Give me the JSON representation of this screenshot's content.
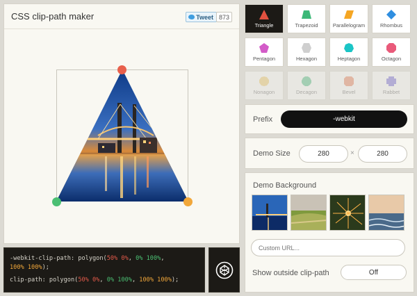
{
  "header": {
    "title": "CSS clip-path maker",
    "tweet_label": "Tweet",
    "tweet_count": "873"
  },
  "code": {
    "line1_prop": "-webkit-clip-path: polygon(",
    "line2_prop": "clip-path: polygon(",
    "p1": "50% 0%",
    "p2": "0% 100%",
    "p3": "100% 100%",
    "comma": ", ",
    "end": ");"
  },
  "shapes": [
    {
      "label": "Triangle",
      "icon": "triangle-icon",
      "color": "#e2513f",
      "active": true
    },
    {
      "label": "Trapezoid",
      "icon": "trapezoid-icon",
      "color": "#3cb878"
    },
    {
      "label": "Parallelogram",
      "icon": "parallelogram-icon",
      "color": "#f5a623"
    },
    {
      "label": "Rhombus",
      "icon": "rhombus-icon",
      "color": "#2f8ee0"
    },
    {
      "label": "Pentagon",
      "icon": "pentagon-icon",
      "color": "#d35bc8"
    },
    {
      "label": "Hexagon",
      "icon": "hexagon-icon",
      "color": "#cfcfcf"
    },
    {
      "label": "Heptagon",
      "icon": "heptagon-icon",
      "color": "#1bc5c6"
    },
    {
      "label": "Octagon",
      "icon": "octagon-icon",
      "color": "#e95a7a"
    },
    {
      "label": "Nonagon",
      "icon": "nonagon-icon",
      "color": "#f1c75c",
      "faded": true
    },
    {
      "label": "Decagon",
      "icon": "decagon-icon",
      "color": "#3cb878",
      "faded": true
    },
    {
      "label": "Bevel",
      "icon": "bevel-icon",
      "color": "#e9754c",
      "faded": true
    },
    {
      "label": "Rabbet",
      "icon": "rabbet-icon",
      "color": "#6a5bd6",
      "faded": true
    }
  ],
  "prefix": {
    "label": "Prefix",
    "value": "-webkit"
  },
  "demo_size": {
    "label": "Demo Size",
    "width": "280",
    "sep": "×",
    "height": "280"
  },
  "demo_background": {
    "label": "Demo Background",
    "custom_url_placeholder": "Custom URL..."
  },
  "outside": {
    "label": "Show outside clip-path",
    "value": "Off"
  },
  "colors": {
    "handle_top": "#e8604c",
    "handle_left": "#4bbf73",
    "handle_right": "#f1a73a"
  }
}
